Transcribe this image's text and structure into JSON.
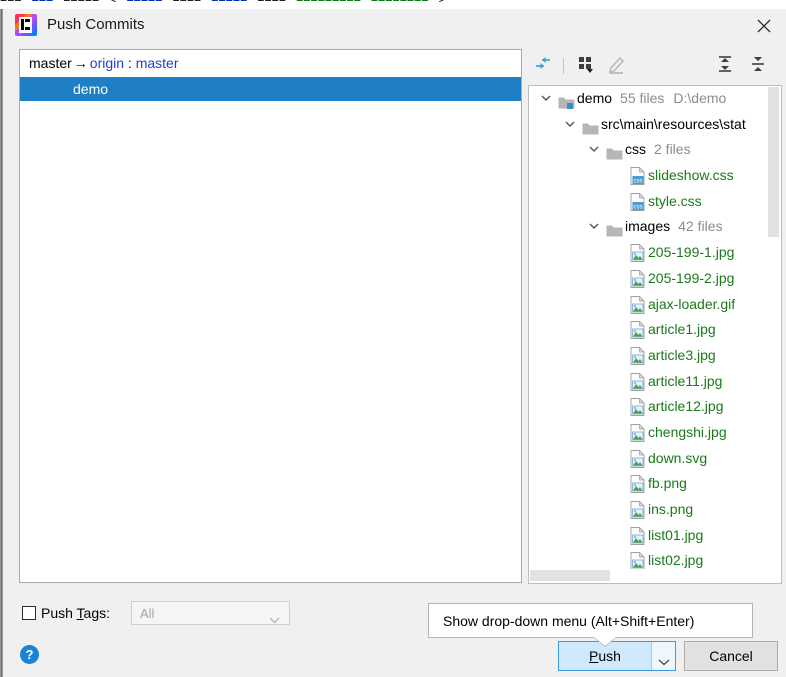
{
  "background_strip": {
    "fragments": [
      {
        "text": "===",
        "color": "dark"
      },
      {
        "text": "===",
        "color": "blue"
      },
      {
        "text": "=====",
        "color": "dark"
      },
      {
        "text": "<",
        "color": "dark"
      },
      {
        "text": "=====",
        "color": "blue"
      },
      {
        "text": "====",
        "color": "dark"
      },
      {
        "text": "=====",
        "color": "blue"
      },
      {
        "text": "====",
        "color": "dark"
      },
      {
        "text": "=========",
        "color": "green"
      },
      {
        "text": "========",
        "color": "green"
      },
      {
        "text": ">",
        "color": "dark"
      }
    ]
  },
  "dialog": {
    "title": "Push Commits",
    "app_icon": "intellij-idea-icon",
    "close_icon": "close-icon"
  },
  "commit_list": {
    "branch_row": {
      "source": "master",
      "arrow": "→",
      "remote": "origin",
      "separator": " : ",
      "target": "master"
    },
    "commits": [
      {
        "message": "demo",
        "selected": true
      }
    ]
  },
  "tree_toolbar": {
    "buttons": [
      {
        "name": "collapse-selection-icon",
        "label": "Collapse Selection",
        "enabled": true
      },
      {
        "name": "group-by-icon",
        "label": "Group By",
        "enabled": true
      },
      {
        "name": "edit-source-icon",
        "label": "Edit Source",
        "enabled": false
      },
      {
        "name": "expand-all-icon",
        "label": "Expand All",
        "enabled": true
      },
      {
        "name": "collapse-all-icon",
        "label": "Collapse All",
        "enabled": true
      }
    ]
  },
  "file_tree": {
    "rows": [
      {
        "indent": 0,
        "twisty": "expanded",
        "icon": "module-folder-icon",
        "label": "demo",
        "meta": "55 files",
        "meta2": "D:\\demo",
        "color": "default"
      },
      {
        "indent": 1,
        "twisty": "expanded",
        "icon": "folder-icon",
        "label": "src\\main\\resources\\stat",
        "meta": "",
        "meta2": "",
        "color": "default"
      },
      {
        "indent": 2,
        "twisty": "expanded",
        "icon": "folder-icon",
        "label": "css",
        "meta": "2 files",
        "meta2": "",
        "color": "default"
      },
      {
        "indent": 3,
        "twisty": "none",
        "icon": "css-file-icon",
        "label": "slideshow.css",
        "meta": "",
        "meta2": "",
        "color": "green"
      },
      {
        "indent": 3,
        "twisty": "none",
        "icon": "css-file-icon",
        "label": "style.css",
        "meta": "",
        "meta2": "",
        "color": "green"
      },
      {
        "indent": 2,
        "twisty": "expanded",
        "icon": "folder-icon",
        "label": "images",
        "meta": "42 files",
        "meta2": "",
        "color": "default"
      },
      {
        "indent": 3,
        "twisty": "none",
        "icon": "image-file-icon",
        "label": "205-199-1.jpg",
        "meta": "",
        "meta2": "",
        "color": "green"
      },
      {
        "indent": 3,
        "twisty": "none",
        "icon": "image-file-icon",
        "label": "205-199-2.jpg",
        "meta": "",
        "meta2": "",
        "color": "green"
      },
      {
        "indent": 3,
        "twisty": "none",
        "icon": "image-file-icon",
        "label": "ajax-loader.gif",
        "meta": "",
        "meta2": "",
        "color": "green"
      },
      {
        "indent": 3,
        "twisty": "none",
        "icon": "image-file-icon",
        "label": "article1.jpg",
        "meta": "",
        "meta2": "",
        "color": "green"
      },
      {
        "indent": 3,
        "twisty": "none",
        "icon": "image-file-icon",
        "label": "article3.jpg",
        "meta": "",
        "meta2": "",
        "color": "green"
      },
      {
        "indent": 3,
        "twisty": "none",
        "icon": "image-file-icon",
        "label": "article11.jpg",
        "meta": "",
        "meta2": "",
        "color": "green"
      },
      {
        "indent": 3,
        "twisty": "none",
        "icon": "image-file-icon",
        "label": "article12.jpg",
        "meta": "",
        "meta2": "",
        "color": "green"
      },
      {
        "indent": 3,
        "twisty": "none",
        "icon": "image-file-icon",
        "label": "chengshi.jpg",
        "meta": "",
        "meta2": "",
        "color": "green"
      },
      {
        "indent": 3,
        "twisty": "none",
        "icon": "image-file-icon",
        "label": "down.svg",
        "meta": "",
        "meta2": "",
        "color": "green"
      },
      {
        "indent": 3,
        "twisty": "none",
        "icon": "image-file-icon",
        "label": "fb.png",
        "meta": "",
        "meta2": "",
        "color": "green"
      },
      {
        "indent": 3,
        "twisty": "none",
        "icon": "image-file-icon",
        "label": "ins.png",
        "meta": "",
        "meta2": "",
        "color": "green"
      },
      {
        "indent": 3,
        "twisty": "none",
        "icon": "image-file-icon",
        "label": "list01.jpg",
        "meta": "",
        "meta2": "",
        "color": "green"
      },
      {
        "indent": 3,
        "twisty": "none",
        "icon": "image-file-icon",
        "label": "list02.jpg",
        "meta": "",
        "meta2": "",
        "color": "green"
      }
    ]
  },
  "bottom": {
    "push_tags_label_pre": "Push ",
    "push_tags_mnemonic": "T",
    "push_tags_label_post": "ags:",
    "push_tags_checked": false,
    "tags_combo_value": "All",
    "tags_combo_enabled": false,
    "help_icon": "help-icon",
    "help_glyph": "?"
  },
  "tooltip": {
    "text": "Show drop-down menu (Alt+Shift+Enter)"
  },
  "buttons": {
    "push_label_pre": "",
    "push_mnemonic": "P",
    "push_label_post": "ush",
    "push_dropdown_icon": "chevron-down-icon",
    "cancel_label": "Cancel"
  },
  "colors": {
    "selection_blue": "#1e7fc4",
    "added_green": "#1a7a1a",
    "branch_blue": "#2040d0",
    "focus_blue": "#3d9ae8",
    "help_blue": "#1a83d6"
  }
}
